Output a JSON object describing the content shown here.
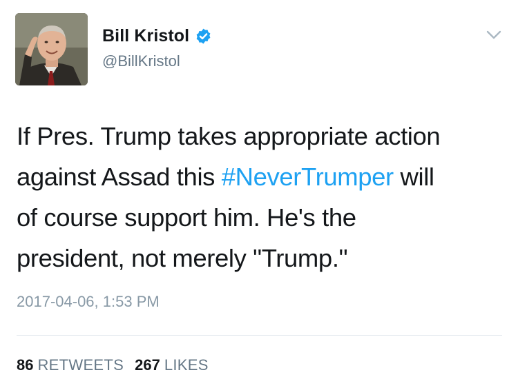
{
  "author": {
    "display_name": "Bill Kristol",
    "handle": "@BillKristol",
    "verified": true,
    "avatar_icon": "profile-photo"
  },
  "tweet": {
    "lines": [
      [
        "If Pres. Trump takes appropriate action"
      ],
      [
        "against Assad this ",
        "#NeverTrumper",
        " will"
      ],
      [
        "of course support him. He's the"
      ],
      [
        "president, not merely \"Trump.\""
      ]
    ],
    "hashtag": "#NeverTrumper",
    "timestamp": "2017-04-06, 1:53 PM"
  },
  "stats": {
    "retweets_count": "86",
    "retweets_label": "RETWEETS",
    "likes_count": "267",
    "likes_label": "LIKES"
  },
  "menu": {
    "icon": "chevron-down-icon"
  },
  "colors": {
    "text": "#14171a",
    "secondary": "#657786",
    "timestamp": "#8899a6",
    "link": "#1da1f2",
    "verified_badge": "#1da1f2",
    "divider": "#e1e8ed"
  }
}
